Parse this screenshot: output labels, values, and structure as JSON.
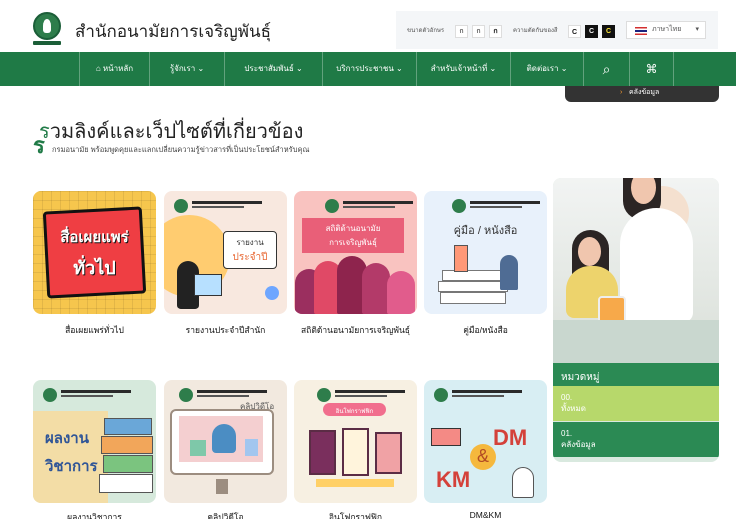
{
  "header": {
    "title": "สำนักอนามัยการเจริญพันธุ์",
    "font_size_label": "ขนาดตัวอักษร",
    "font_buttons": [
      "ก",
      "ก",
      "ก"
    ],
    "contrast_label": "ความตัดกันของสี",
    "contrast_buttons": [
      "C",
      "C",
      "C"
    ],
    "language": "ภาษาไทย"
  },
  "nav": {
    "items": [
      "หน้าหลัก",
      "รู้จักเรา",
      "ประชาสัมพันธ์",
      "บริการประชาชน",
      "สำหรับเจ้าหน้าที่",
      "ติดต่อเรา"
    ],
    "dropdown_item": "คลังข้อมูล"
  },
  "section": {
    "first_letter": "ร",
    "title": "วมลิงค์และเว็ปไซต์ที่เกี่ยวข้อง",
    "first_letter2": "ร",
    "subtitle": "กรมอนามัย พร้อมพูดคุยและแลกเปลี่ยนความรู้ข่าวสารที่เป็นประโยชน์สำหรับคุณ"
  },
  "cards": [
    {
      "label": "สื่อเผยแพร่ทั่วไป",
      "art_text": [
        "สื่อเผยแพร่",
        "ทั่วไป"
      ]
    },
    {
      "label": "รายงานประจำปีสำนัก",
      "art_text": [
        "รายงาน",
        "ประจำปี"
      ]
    },
    {
      "label": "สถิติด้านอนามัยการเจริญพันธุ์",
      "art_text": [
        "สถิติด้านอนามัย",
        "การเจริญพันธุ์"
      ]
    },
    {
      "label": "คู่มือ/หนังสือ",
      "art_text": [
        "คู่มือ / หนังสือ"
      ]
    },
    {
      "label": "ผลงานวิชาการ",
      "art_text": [
        "ผลงาน",
        "วิชาการ"
      ]
    },
    {
      "label": "คลิปวิดีโอ",
      "art_text": [
        "คลิปวิดีโอ"
      ]
    },
    {
      "label": "อินโฟกราฟฟิก",
      "art_text": [
        "อินโฟกราฟฟิก"
      ]
    },
    {
      "label": "DM&KM",
      "art_text": [
        "DM",
        "&",
        "KM"
      ]
    }
  ],
  "categories": {
    "heading": "หมวดหมู่",
    "items": [
      {
        "code": "00.",
        "label": "ทั้งหมด"
      },
      {
        "code": "01.",
        "label": "คลังข้อมูล"
      }
    ]
  },
  "colors": {
    "brand": "#1f7a46",
    "panel_active": "#b7d86b",
    "panel_dark": "#2b8a54"
  },
  "icons": [
    "home-icon",
    "chevron-down-icon",
    "search-icon",
    "sitemap-icon",
    "flag-icon",
    "logo-icon"
  ]
}
